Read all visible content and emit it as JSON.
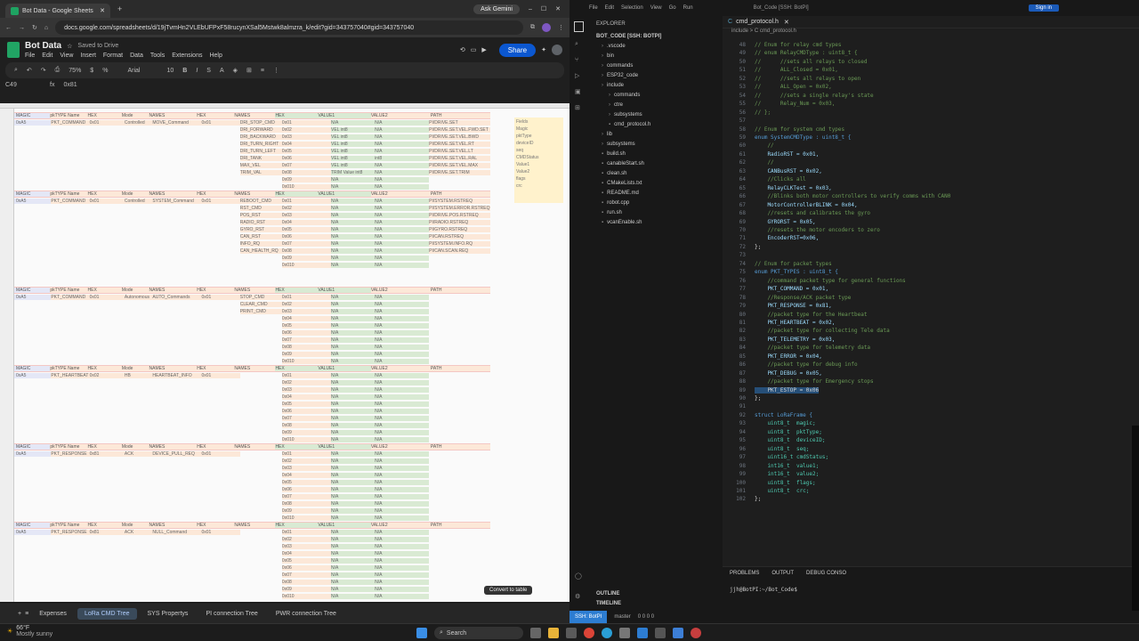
{
  "browser": {
    "tab_title": "Bot Data - Google Sheets",
    "gemini_label": "Ask Gemini",
    "url": "docs.google.com/spreadsheets/d/19jTvmHn2VLEbUFPxF58rucynXSal5Mstwk8almzra_k/edit?gid=343757040#gid=343757040"
  },
  "sheets": {
    "doc_title": "Bot Data",
    "saved_status": "Saved to Drive",
    "menu": [
      "File",
      "Edit",
      "View",
      "Insert",
      "Format",
      "Data",
      "Tools",
      "Extensions",
      "Help"
    ],
    "share_label": "Share",
    "zoom": "75%",
    "font": "Arial",
    "font_size": "10",
    "cell_ref": "C49",
    "formula": "0x81",
    "convert_label": "Convert to table",
    "sheet_tabs": [
      "Expenses",
      "LoRa CMD Tree",
      "SYS Propertys",
      "PI connection Tree",
      "PWR connection Tree"
    ],
    "active_tab": "LoRa CMD Tree",
    "headers": [
      "MAGIC",
      "pkTYPE Name",
      "HEX",
      "Mode",
      "NAMES",
      "HEX",
      "NAMES",
      "HEX",
      "VALUE1",
      "VALUE2",
      "PATH"
    ],
    "blocks": [
      {
        "magic": "0xA5",
        "type": "PKT_COMMAND",
        "hex": "0x01",
        "mode": "Controlled",
        "name": "MOVE_Command",
        "nhex": "0x01",
        "rows": [
          [
            "DRI_STOP_CMD",
            "0x01",
            "N/A",
            "N/A",
            "PI/DRIVE.SET"
          ],
          [
            "DRI_FORWARD",
            "0x02",
            "VEL int8",
            "N/A",
            "PI/DRIVE.SET.VEL.FWD.SET"
          ],
          [
            "DRI_BACKWARD",
            "0x03",
            "VEL int8",
            "N/A",
            "PI/DRIVE.SET.VEL.BWD"
          ],
          [
            "DRI_TURN_RIGHT",
            "0x04",
            "VEL int8",
            "N/A",
            "PI/DRIVE.SET.VEL.RT"
          ],
          [
            "DRI_TURN_LEFT",
            "0x05",
            "VEL int8",
            "N/A",
            "PI/DRIVE.SET.VEL.LT"
          ],
          [
            "DRI_TANK",
            "0x06",
            "VEL int8",
            "int8",
            "PI/DRIVE.SET.VEL.RAL"
          ],
          [
            "MAX_VEL",
            "0x07",
            "VEL int8",
            "N/A",
            "PI/DRIVE.SET.VEL.MAX"
          ],
          [
            "TRIM_VAL",
            "0x08",
            "TRIM Value int8",
            "N/A",
            "PI/DRIVE.SET.TRIM"
          ]
        ]
      },
      {
        "magic": "0xA5",
        "type": "PKT_COMMAND",
        "hex": "0x01",
        "mode": "Controlled",
        "name": "SYSTEM_Command",
        "nhex": "0x01",
        "rows": [
          [
            "REBOOT_CMD",
            "0x01",
            "N/A",
            "N/A",
            "PI/SYSTEM.RSTREQ"
          ],
          [
            "RST_CMD",
            "0x02",
            "N/A",
            "N/A",
            "PI/SYSTEM.ERROR.RSTREQ"
          ],
          [
            "POS_RST",
            "0x03",
            "N/A",
            "N/A",
            "PI/DRIVE.POS.RSTREQ"
          ],
          [
            "RADIO_RST",
            "0x04",
            "N/A",
            "N/A",
            "PI/RADIO.RSTREQ"
          ],
          [
            "GYRO_RST",
            "0x05",
            "N/A",
            "N/A",
            "PI/GYRO.RSTREQ"
          ],
          [
            "CAN_RST",
            "0x06",
            "N/A",
            "N/A",
            "PI/CAN.RSTREQ"
          ],
          [
            "INFO_RQ",
            "0x07",
            "N/A",
            "N/A",
            "PI/SYSTEM.INFO.RQ"
          ],
          [
            "CAN_HEALTH_RQ",
            "0x08",
            "N/A",
            "N/A",
            "PI/CAN.SCAN.REQ"
          ]
        ]
      },
      {
        "magic": "0xA5",
        "type": "PKT_COMMAND",
        "hex": "0x01",
        "mode": "Autonomous",
        "name": "AUTO_Commands",
        "nhex": "0x01",
        "rows": [
          [
            "STOP_CMD",
            "0x01",
            "N/A",
            "N/A",
            ""
          ],
          [
            "CLEAR_CMD",
            "0x02",
            "N/A",
            "N/A",
            ""
          ],
          [
            "PRINT_CMD",
            "0x03",
            "N/A",
            "N/A",
            ""
          ]
        ]
      },
      {
        "magic": "0xA5",
        "type": "PKT_HEARTBEAT",
        "hex": "0x02",
        "mode": "HB",
        "name": "HEARTBEAT_INFO",
        "nhex": "0x01",
        "rows": [
          [
            "",
            "0x01",
            "N/A",
            "N/A",
            ""
          ]
        ]
      },
      {
        "magic": "0xA5",
        "type": "PKT_RESPONSE",
        "hex": "0x81",
        "mode": "ACK",
        "name": "DEVICE_PULL_REQ",
        "nhex": "0x01",
        "rows": [
          [
            "",
            "0x01",
            "N/A",
            "N/A",
            ""
          ]
        ]
      },
      {
        "magic": "0xA5",
        "type": "PKT_RESPONSE",
        "hex": "0x81",
        "mode": "ACK",
        "name": "NULL_Command",
        "nhex": "0x01",
        "rows": [
          [
            "",
            "0x01",
            "N/A",
            "N/A",
            ""
          ]
        ]
      }
    ],
    "fields_box": [
      "Fields",
      "Magic",
      "pktType",
      "deviceID",
      "seq",
      "CMDStatus",
      "Value1",
      "Value2",
      "flags",
      "crc"
    ],
    "fields_note": "Command",
    "fields_note2": "Magic (LoRa"
  },
  "vscode": {
    "menu": [
      "File",
      "Edit",
      "Selection",
      "View",
      "Go",
      "Run"
    ],
    "title": "Bot_Code [SSH: BotPI]",
    "signin": "Sign in",
    "explorer_label": "EXPLORER",
    "root": "BOT_CODE [SSH: BOTPI]",
    "files": [
      ".vscode",
      "bin",
      "commands",
      "ESP32_code",
      "include",
      "commands",
      "ctre",
      "subsystems",
      "cmd_protocol.h",
      "lib",
      "subsystems",
      "build.sh",
      "canableStart.sh",
      "clean.sh",
      "CMakeLists.txt",
      "README.md",
      "robot.cpp",
      "run.sh",
      "vcanEnable.sh"
    ],
    "tab": "cmd_protocol.h",
    "breadcrumb": "include > C cmd_protocol.h",
    "outline": "OUTLINE",
    "timeline": "TIMELINE",
    "panel_tabs": [
      "PROBLEMS",
      "OUTPUT",
      "DEBUG CONSO"
    ],
    "terminal": "jjh@BotPI:~/Bot_Code$",
    "status_remote": "SSH: BotPI",
    "status_branch": "master",
    "status_counts": "0 0 0 0",
    "code": [
      {
        "n": "48",
        "t": "// Enum for relay cmd types",
        "c": "cm"
      },
      {
        "n": "49",
        "t": "// enum RelayCMDType : uint8_t {",
        "c": "cm"
      },
      {
        "n": "50",
        "t": "//      //sets all relays to closed",
        "c": "cm"
      },
      {
        "n": "51",
        "t": "//      ALL_Closed = 0x01,",
        "c": "cm"
      },
      {
        "n": "52",
        "t": "//      //sets all relays to open",
        "c": "cm"
      },
      {
        "n": "53",
        "t": "//      ALL_Open = 0x02,",
        "c": "cm"
      },
      {
        "n": "54",
        "t": "//      //sets a single relay's state",
        "c": "cm"
      },
      {
        "n": "55",
        "t": "//      Relay_Num = 0x03,",
        "c": "cm"
      },
      {
        "n": "56",
        "t": "// };",
        "c": "cm"
      },
      {
        "n": "57",
        "t": "",
        "c": ""
      },
      {
        "n": "58",
        "t": "// Enum for system cmd types",
        "c": "cm"
      },
      {
        "n": "59",
        "t": "enum SystemCMDType : uint8_t {",
        "c": "kw"
      },
      {
        "n": "60",
        "t": "    //",
        "c": "cm"
      },
      {
        "n": "61",
        "t": "    RadioRST = 0x01,",
        "c": "vr"
      },
      {
        "n": "62",
        "t": "    //",
        "c": "cm"
      },
      {
        "n": "63",
        "t": "    CANBusRST = 0x02,",
        "c": "vr"
      },
      {
        "n": "64",
        "t": "    //Clicks all",
        "c": "cm"
      },
      {
        "n": "65",
        "t": "    RelayCLKTest = 0x03,",
        "c": "vr"
      },
      {
        "n": "66",
        "t": "    //Blinks both motor controllers to verify comms with CAN0",
        "c": "cm"
      },
      {
        "n": "67",
        "t": "    MotorControllerBLINK = 0x04,",
        "c": "vr"
      },
      {
        "n": "68",
        "t": "    //resets and calibrates the gyro",
        "c": "cm"
      },
      {
        "n": "69",
        "t": "    GYRORST = 0x05,",
        "c": "vr"
      },
      {
        "n": "70",
        "t": "    //resets the motor encoders to zero",
        "c": "cm"
      },
      {
        "n": "71",
        "t": "    EncoderRST=0x06,",
        "c": "vr"
      },
      {
        "n": "72",
        "t": "};",
        "c": ""
      },
      {
        "n": "73",
        "t": "",
        "c": ""
      },
      {
        "n": "74",
        "t": "// Enum for packet types",
        "c": "cm"
      },
      {
        "n": "75",
        "t": "enum PKT_TYPES : uint8_t {",
        "c": "kw"
      },
      {
        "n": "76",
        "t": "    //command packet type for general functions",
        "c": "cm"
      },
      {
        "n": "77",
        "t": "    PKT_COMMAND = 0x01,",
        "c": "vr"
      },
      {
        "n": "78",
        "t": "    //Response/ACK packet type",
        "c": "cm"
      },
      {
        "n": "79",
        "t": "    PKT_RESPONSE = 0x81,",
        "c": "vr"
      },
      {
        "n": "80",
        "t": "    //packet type for the Heartbeat",
        "c": "cm"
      },
      {
        "n": "81",
        "t": "    PKT_HEARTBEAT = 0x02,",
        "c": "vr"
      },
      {
        "n": "82",
        "t": "    //packet type for collecting Tele data",
        "c": "cm"
      },
      {
        "n": "83",
        "t": "    PKT_TELEMETRY = 0x03,",
        "c": "vr"
      },
      {
        "n": "84",
        "t": "    //packet type for telemetry data",
        "c": "cm"
      },
      {
        "n": "85",
        "t": "    PKT_ERROR = 0x04,",
        "c": "vr"
      },
      {
        "n": "86",
        "t": "    //packet type for debug info",
        "c": "cm"
      },
      {
        "n": "87",
        "t": "    PKT_DEBUG = 0x05,",
        "c": "vr"
      },
      {
        "n": "88",
        "t": "    //packet type for Emergency stops",
        "c": "cm"
      },
      {
        "n": "89",
        "t": "    PKT_ESTOP = 0x06",
        "c": "hl"
      },
      {
        "n": "90",
        "t": "};",
        "c": ""
      },
      {
        "n": "91",
        "t": "",
        "c": ""
      },
      {
        "n": "92",
        "t": "struct LoRaFrame {",
        "c": "kw"
      },
      {
        "n": "93",
        "t": "    uint8_t  magic;",
        "c": "ty"
      },
      {
        "n": "94",
        "t": "    uint8_t  pktType;",
        "c": "ty"
      },
      {
        "n": "95",
        "t": "    uint8_t  deviceID;",
        "c": "ty"
      },
      {
        "n": "96",
        "t": "    uint8_t  seq;",
        "c": "ty"
      },
      {
        "n": "97",
        "t": "    uint16_t cmdStatus;",
        "c": "ty"
      },
      {
        "n": "98",
        "t": "    int16_t  value1;",
        "c": "ty"
      },
      {
        "n": "99",
        "t": "    int16_t  value2;",
        "c": "ty"
      },
      {
        "n": "100",
        "t": "    uint8_t  flags;",
        "c": "ty"
      },
      {
        "n": "101",
        "t": "    uint8_t  crc;",
        "c": "ty"
      },
      {
        "n": "102",
        "t": "};",
        "c": ""
      }
    ]
  },
  "taskbar": {
    "weather_temp": "66°F",
    "weather_desc": "Mostly sunny",
    "search": "Search"
  },
  "colors": {
    "accent": "#0b57d0",
    "sheets_green": "#1ea362",
    "vscode_blue": "#2d7dd2"
  }
}
